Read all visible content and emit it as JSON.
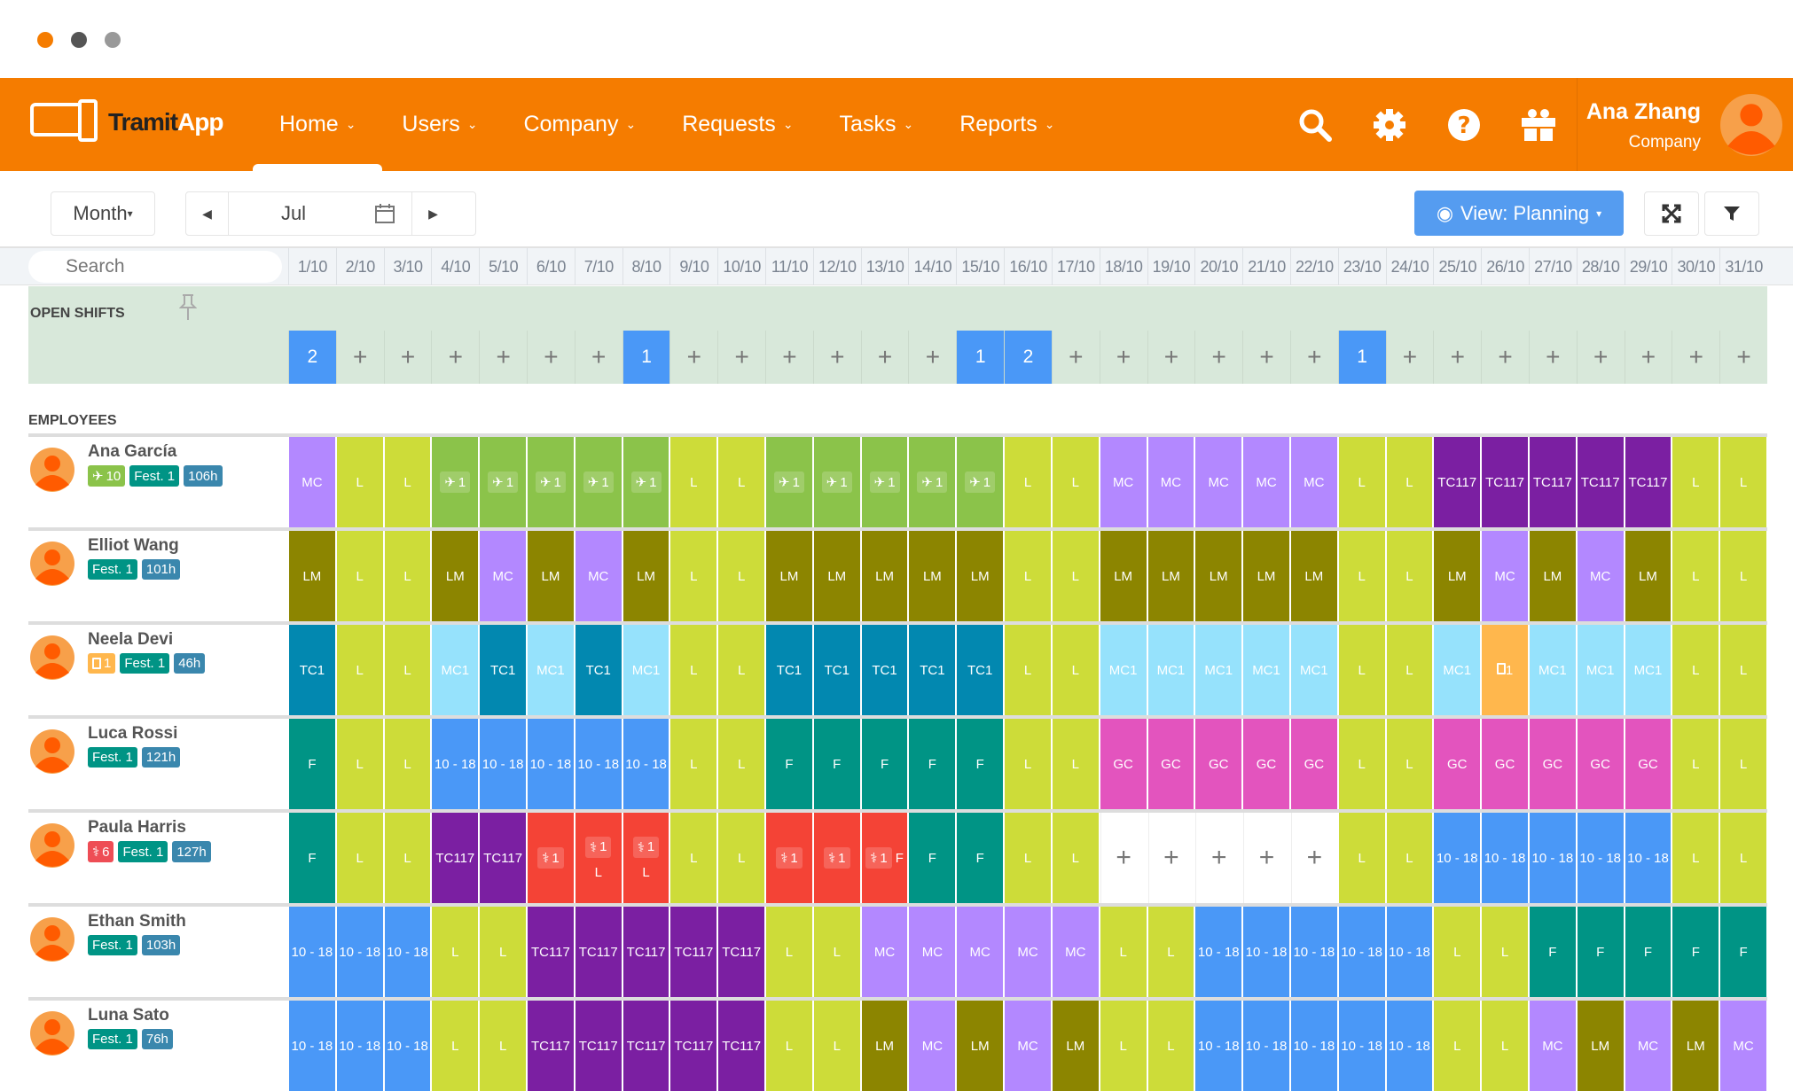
{
  "window_controls": {
    "colors": [
      "#f57c00",
      "#555555",
      "#999999"
    ]
  },
  "brand": {
    "name_part1": "Tramit",
    "name_part2": "App"
  },
  "nav": [
    {
      "label": "Home",
      "active": true
    },
    {
      "label": "Users"
    },
    {
      "label": "Company"
    },
    {
      "label": "Requests"
    },
    {
      "label": "Tasks"
    },
    {
      "label": "Reports"
    }
  ],
  "header_icons": [
    "search-icon",
    "gear-icon",
    "help-icon",
    "gift-icon"
  ],
  "user": {
    "name": "Ana Zhang",
    "role": "Company"
  },
  "toolbar": {
    "period": "Month",
    "month": "Jul",
    "view": "View: Planning"
  },
  "search": {
    "placeholder": "Search"
  },
  "days": [
    "1/10",
    "2/10",
    "3/10",
    "4/10",
    "5/10",
    "6/10",
    "7/10",
    "8/10",
    "9/10",
    "10/10",
    "11/10",
    "12/10",
    "13/10",
    "14/10",
    "15/10",
    "16/10",
    "17/10",
    "18/10",
    "19/10",
    "20/10",
    "21/10",
    "22/10",
    "23/10",
    "24/10",
    "25/10",
    "26/10",
    "27/10",
    "28/10",
    "29/10",
    "30/10",
    "31/10"
  ],
  "open_shifts": {
    "title": "OPEN SHIFTS",
    "cells": [
      "2",
      "+",
      "+",
      "+",
      "+",
      "+",
      "+",
      "1",
      "+",
      "+",
      "+",
      "+",
      "+",
      "+",
      "1",
      "2",
      "+",
      "+",
      "+",
      "+",
      "+",
      "+",
      "1",
      "+",
      "+",
      "+",
      "+",
      "+",
      "+",
      "+",
      "+"
    ]
  },
  "employees_title": "EMPLOYEES",
  "colors": {
    "L": "#cddc39",
    "MC": "#b388ff",
    "LM": "#8c8500",
    "TC1": "#0288b0",
    "MC1": "#96e2fc",
    "10 - 18": "#4a98f7",
    "F": "#009485",
    "GC": "#e354be",
    "TC117": "#7b1fa2",
    "sick": "#f44336",
    "vacation": "#8bc34a",
    "doc": "#ffb74d",
    "fest": "#009485",
    "hours": "#3a87ad",
    "sick_badge": "#ee4d55"
  },
  "employees": [
    {
      "name": "Ana García",
      "badges": [
        {
          "kind": "vacation",
          "icon": "plane",
          "text": "10"
        },
        {
          "kind": "fest",
          "text": "Fest. 1"
        },
        {
          "kind": "hours",
          "text": "106h"
        }
      ],
      "cells": [
        "MC",
        "L",
        "L",
        {
          "kind": "vacation",
          "icon": "plane",
          "count": "1"
        },
        {
          "kind": "vacation",
          "icon": "plane",
          "count": "1"
        },
        {
          "kind": "vacation",
          "icon": "plane",
          "count": "1"
        },
        {
          "kind": "vacation",
          "icon": "plane",
          "count": "1"
        },
        {
          "kind": "vacation",
          "icon": "plane",
          "count": "1"
        },
        "L",
        "L",
        {
          "kind": "vacation",
          "icon": "plane",
          "count": "1"
        },
        {
          "kind": "vacation",
          "icon": "plane",
          "count": "1"
        },
        {
          "kind": "vacation",
          "icon": "plane",
          "count": "1"
        },
        {
          "kind": "vacation",
          "icon": "plane",
          "count": "1"
        },
        {
          "kind": "vacation",
          "icon": "plane",
          "count": "1"
        },
        "L",
        "L",
        "MC",
        "MC",
        "MC",
        "MC",
        "MC",
        "L",
        "L",
        "TC117",
        "TC117",
        "TC117",
        "TC117",
        "TC117",
        "L",
        "L"
      ]
    },
    {
      "name": "Elliot Wang",
      "badges": [
        {
          "kind": "fest",
          "text": "Fest. 1"
        },
        {
          "kind": "hours",
          "text": "101h"
        }
      ],
      "cells": [
        "LM",
        "L",
        "L",
        "LM",
        "MC",
        "LM",
        "MC",
        "LM",
        "L",
        "L",
        "LM",
        "LM",
        "LM",
        "LM",
        "LM",
        "L",
        "L",
        "LM",
        "LM",
        "LM",
        "LM",
        "LM",
        "L",
        "L",
        "LM",
        "MC",
        "LM",
        "MC",
        "LM",
        "L",
        "L"
      ]
    },
    {
      "name": "Neela Devi",
      "badges": [
        {
          "kind": "doc",
          "icon": "document",
          "text": "1"
        },
        {
          "kind": "fest",
          "text": "Fest. 1"
        },
        {
          "kind": "hours",
          "text": "46h"
        }
      ],
      "cells": [
        "TC1",
        "L",
        "L",
        "MC1",
        "TC1",
        "MC1",
        "TC1",
        "MC1",
        "L",
        "L",
        "TC1",
        "TC1",
        "TC1",
        "TC1",
        "TC1",
        "L",
        "L",
        "MC1",
        "MC1",
        "MC1",
        "MC1",
        "MC1",
        "L",
        "L",
        "MC1",
        {
          "kind": "doc",
          "icon": "document",
          "count": "1"
        },
        "MC1",
        "MC1",
        "MC1",
        "L",
        "L"
      ]
    },
    {
      "name": "Luca Rossi",
      "badges": [
        {
          "kind": "fest",
          "text": "Fest. 1"
        },
        {
          "kind": "hours",
          "text": "121h"
        }
      ],
      "cells": [
        "F",
        "L",
        "L",
        "10 - 18",
        "10 - 18",
        "10 - 18",
        "10 - 18",
        "10 - 18",
        "L",
        "L",
        "F",
        "F",
        "F",
        "F",
        "F",
        "L",
        "L",
        "GC",
        "GC",
        "GC",
        "GC",
        "GC",
        "L",
        "L",
        "GC",
        "GC",
        "GC",
        "GC",
        "GC",
        "L",
        "L"
      ]
    },
    {
      "name": "Paula Harris",
      "badges": [
        {
          "kind": "sick_badge",
          "icon": "stethoscope",
          "text": "6"
        },
        {
          "kind": "fest",
          "text": "Fest. 1"
        },
        {
          "kind": "hours",
          "text": "127h"
        }
      ],
      "cells": [
        "F",
        "L",
        "L",
        "TC117",
        "TC117",
        {
          "kind": "sick",
          "icon": "stethoscope",
          "count": "1"
        },
        {
          "kind": "sick",
          "icon": "stethoscope",
          "count": "1",
          "label": "L"
        },
        {
          "kind": "sick",
          "icon": "stethoscope",
          "count": "1",
          "label": "L"
        },
        "L",
        "L",
        {
          "kind": "sick",
          "icon": "stethoscope",
          "count": "1"
        },
        {
          "kind": "sick",
          "icon": "stethoscope",
          "count": "1"
        },
        {
          "kind": "sick",
          "icon": "stethoscope",
          "count": "1",
          "suffix": "F"
        },
        "F",
        "F",
        "L",
        "L",
        "+",
        "+",
        "+",
        "+",
        "+",
        "L",
        "L",
        "10 - 18",
        "10 - 18",
        "10 - 18",
        "10 - 18",
        "10 - 18",
        "L",
        "L"
      ]
    },
    {
      "name": "Ethan Smith",
      "badges": [
        {
          "kind": "fest",
          "text": "Fest. 1"
        },
        {
          "kind": "hours",
          "text": "103h"
        }
      ],
      "cells": [
        "10 - 18",
        "10 - 18",
        "10 - 18",
        "L",
        "L",
        "TC117",
        "TC117",
        "TC117",
        "TC117",
        "TC117",
        "L",
        "L",
        "MC",
        "MC",
        "MC",
        "MC",
        "MC",
        "L",
        "L",
        "10 - 18",
        "10 - 18",
        "10 - 18",
        "10 - 18",
        "10 - 18",
        "L",
        "L",
        "F",
        "F",
        "F",
        "F",
        "F"
      ]
    },
    {
      "name": "Luna Sato",
      "badges": [
        {
          "kind": "fest",
          "text": "Fest. 1"
        },
        {
          "kind": "hours",
          "text": "76h"
        }
      ],
      "cells": [
        "10 - 18",
        "10 - 18",
        "10 - 18",
        "L",
        "L",
        "TC117",
        "TC117",
        "TC117",
        "TC117",
        "TC117",
        "L",
        "L",
        "LM",
        "MC",
        "LM",
        "MC",
        "LM",
        "L",
        "L",
        "10 - 18",
        "10 - 18",
        "10 - 18",
        "10 - 18",
        "10 - 18",
        "L",
        "L",
        "MC",
        "LM",
        "MC",
        "LM",
        "MC"
      ]
    }
  ]
}
